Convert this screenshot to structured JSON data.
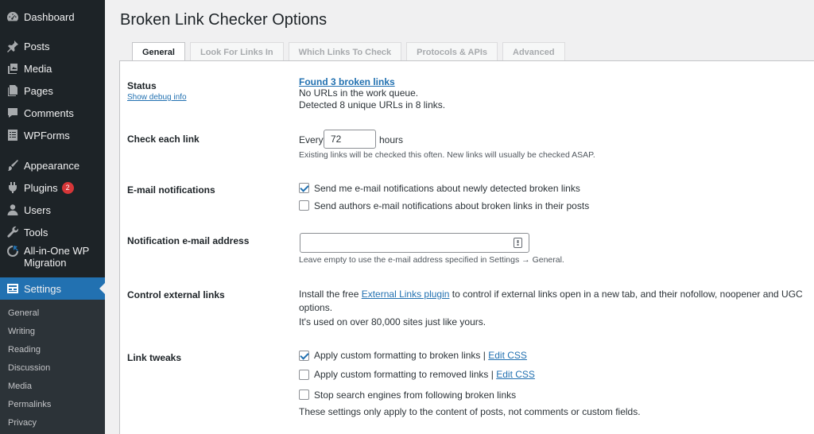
{
  "sidebar": {
    "dashboard": "Dashboard",
    "posts": "Posts",
    "media": "Media",
    "pages": "Pages",
    "comments": "Comments",
    "wpforms": "WPForms",
    "appearance": "Appearance",
    "plugins": "Plugins",
    "plugins_badge": "2",
    "users": "Users",
    "tools": "Tools",
    "aiowpm_line1": "All-in-One WP",
    "aiowpm_line2": "Migration",
    "settings": "Settings",
    "submenu": [
      "General",
      "Writing",
      "Reading",
      "Discussion",
      "Media",
      "Permalinks",
      "Privacy"
    ]
  },
  "page": {
    "title": "Broken Link Checker Options"
  },
  "tabs": [
    "General",
    "Look For Links In",
    "Which Links To Check",
    "Protocols & APIs",
    "Advanced"
  ],
  "status": {
    "label": "Status",
    "debug_link": "Show debug info",
    "found_link": "Found 3 broken links",
    "queue_text": "No URLs in the work queue.",
    "detected_text": "Detected 8 unique URLs in 8 links."
  },
  "check_each": {
    "label": "Check each link",
    "prefix": "Every",
    "value": "72",
    "suffix": "hours",
    "desc": "Existing links will be checked this often. New links will usually be checked ASAP."
  },
  "email_notifications": {
    "label": "E-mail notifications",
    "option1": "Send me e-mail notifications about newly detected broken links",
    "option1_checked": true,
    "option2": "Send authors e-mail notifications about broken links in their posts",
    "option2_checked": false
  },
  "notification_email": {
    "label": "Notification e-mail address",
    "value": "",
    "desc": "Leave empty to use the e-mail address specified in Settings → General."
  },
  "external_links": {
    "label": "Control external links",
    "text_before": "Install the free ",
    "link_text": "External Links plugin",
    "text_after": " to control if external links open in a new tab, and their nofollow, noopener and UGC",
    "text_line2": "options.",
    "text_line3": "It's used on over 80,000 sites just like yours."
  },
  "link_tweaks": {
    "label": "Link tweaks",
    "option1": "Apply custom formatting to broken links",
    "option1_checked": true,
    "option1_link": "Edit CSS",
    "option2": "Apply custom formatting to removed links",
    "option2_checked": false,
    "option2_link": "Edit CSS",
    "option3": "Stop search engines from following broken links",
    "option3_checked": false,
    "separator": "|",
    "desc": "These settings only apply to the content of posts, not comments or custom fields."
  }
}
